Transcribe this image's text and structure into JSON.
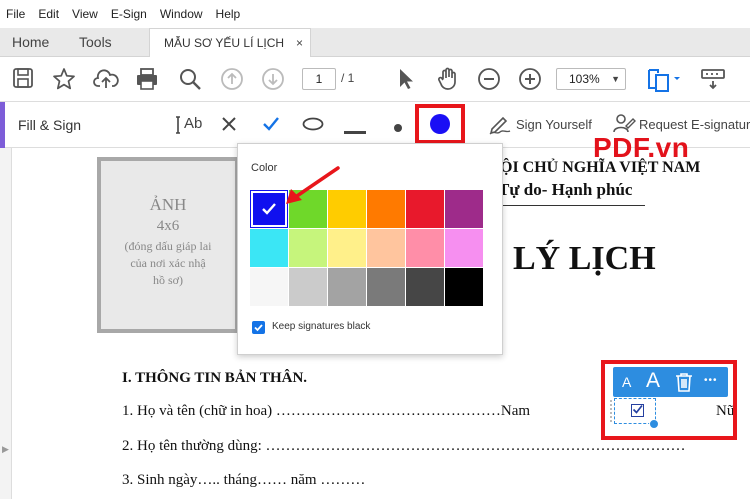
{
  "menubar": {
    "items": [
      "File",
      "Edit",
      "View",
      "E-Sign",
      "Window",
      "Help"
    ]
  },
  "tabs": {
    "home": "Home",
    "tools": "Tools",
    "document": "MẪU SƠ YẾU LÍ LỊCH",
    "close_symbol": "×"
  },
  "toolbar": {
    "page_current": "1",
    "page_total": "/ 1",
    "zoom": "103%",
    "icons": [
      "save-icon",
      "star-icon",
      "upload-cloud-icon",
      "print-icon",
      "search-icon",
      "page-up-icon",
      "page-down-icon",
      "pointer-icon",
      "hand-icon",
      "zoom-out-icon",
      "zoom-in-icon",
      "page-fit-icon",
      "keyboard-icon"
    ]
  },
  "fill_sign": {
    "title": "Fill & Sign",
    "text_tool": "Ab",
    "sign_yourself": "Sign Yourself",
    "request_esign": "Request E-signatur",
    "selected_color": "#1a0ff5"
  },
  "color_picker": {
    "label": "Color",
    "keep_black": "Keep signatures black",
    "keep_black_checked": true,
    "selected_index": 0,
    "swatches": [
      "#1010ef",
      "#6fd82a",
      "#ffcc00",
      "#ff7a00",
      "#e8192c",
      "#9e2b8a",
      "#3be6f5",
      "#c6f57c",
      "#fff08a",
      "#ffc59e",
      "#ff8ea8",
      "#f68ff0",
      "#f6f6f6",
      "#cbcbcb",
      "#a3a3a3",
      "#7a7a7a",
      "#464646",
      "#000000"
    ]
  },
  "document": {
    "photo": {
      "line1": "ẢNH",
      "line2": "4x6",
      "line3": "(đóng dấu giáp lai",
      "line4": "của nơi xác nhậ",
      "line5": "hồ sơ)"
    },
    "header_line1": "ỘI CHỦ NGHĨA VIỆT NAM",
    "header_line2": "Tự do- Hạnh phúc",
    "title": "LÝ LỊCH",
    "section1": "I. THÔNG TIN BẢN THÂN.",
    "line1": "1. Họ và tên (chữ in hoa) ………………………………………Nam",
    "line1_end": "Nữ",
    "line2": "2. Họ tên thường dùng: …………………………………………………………………………",
    "line3": "3. Sinh ngày….. tháng…… năm ………"
  },
  "logo": {
    "text": "PDF.vn"
  },
  "text_context": {
    "small_a": "A",
    "large_a": "A",
    "more": "•••"
  }
}
